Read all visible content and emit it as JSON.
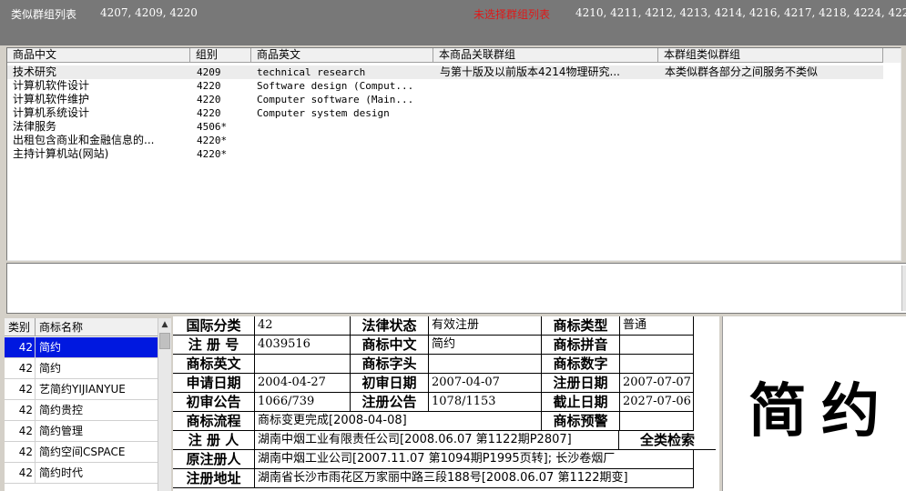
{
  "topbar": {
    "title": "类似群组列表",
    "similar_groups": "4207, 4209, 4220",
    "unselected_label": "未选择群组列表",
    "unselected_groups": "4210, 4211, 4212, 4213, 4214, 4216, 4217, 4218, 4224, 4227"
  },
  "product_list": {
    "columns": [
      "商品中文",
      "组别",
      "商品英文",
      "本商品关联群组",
      "本群组类似群组"
    ],
    "rows": [
      [
        "技术研究",
        "4209",
        "technical research",
        "与第十版及以前版本4214物理研究...",
        "本类似群各部分之间服务不类似"
      ],
      [
        "计算机软件设计",
        "4220",
        "Software design (Comput...",
        "",
        ""
      ],
      [
        "计算机软件维护",
        "4220",
        "Computer software (Main...",
        "",
        ""
      ],
      [
        "计算机系统设计",
        "4220",
        "Computer system design",
        "",
        ""
      ],
      [
        "法律服务",
        "4506*",
        "",
        "",
        ""
      ],
      [
        "出租包含商业和金融信息的...",
        "4220*",
        "",
        "",
        ""
      ],
      [
        "主持计算机站(网站)",
        "4220*",
        "",
        "",
        ""
      ]
    ]
  },
  "brand_list": {
    "col_class": "类别",
    "col_name": "商标名称",
    "rows": [
      [
        "42",
        "简约"
      ],
      [
        "42",
        "简约"
      ],
      [
        "42",
        "艺简约YIJIANYUE"
      ],
      [
        "42",
        "简约贵控"
      ],
      [
        "42",
        "简约管理"
      ],
      [
        "42",
        "简约空间CSPACE"
      ],
      [
        "42",
        "简约时代"
      ]
    ]
  },
  "detail": {
    "intl_class_label": "国际分类",
    "intl_class": "42",
    "legal_status_label": "法律状态",
    "legal_status": "有效注册",
    "mark_type_label": "商标类型",
    "mark_type": "普通",
    "reg_no_label": "注 册 号",
    "reg_no": "4039516",
    "mark_cn_label": "商标中文",
    "mark_cn": "简约",
    "pinyin_label": "商标拼音",
    "pinyin": "",
    "mark_en_label": "商标英文",
    "mark_en": "",
    "initials_label": "商标字头",
    "initials": "",
    "digits_label": "商标数字",
    "digits": "",
    "apply_date_label": "申请日期",
    "apply_date": "2004-04-27",
    "prelim_date_label": "初审日期",
    "prelim_date": "2007-04-07",
    "reg_date_label": "注册日期",
    "reg_date": "2007-07-07",
    "prelim_notice_label": "初审公告",
    "prelim_notice": "1066/739",
    "reg_notice_label": "注册公告",
    "reg_notice": "1078/1153",
    "expiry_label": "截止日期",
    "expiry": "2027-07-06",
    "process_label": "商标流程",
    "process": "商标变更完成[2008-04-08]",
    "warning_label": "商标预警",
    "warning": "",
    "registrant_label": "注 册 人",
    "registrant": "湖南中烟工业有限责任公司[2008.06.07 第1122期P2807]",
    "all_class_search": "全类检索",
    "orig_registrant_label": "原注册人",
    "orig_registrant": "湖南中烟工业公司[2007.11.07 第1094期P1995页转]; 长沙卷烟厂",
    "address_label": "注册地址",
    "address": "湖南省长沙市雨花区万家丽中路三段188号[2008.06.07 第1122期变]"
  },
  "mark_image": {
    "text": "简约"
  }
}
